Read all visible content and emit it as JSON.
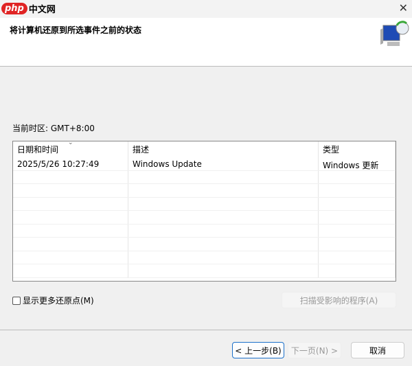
{
  "watermark": "php中文网",
  "window": {
    "close_icon": "close-icon"
  },
  "header": {
    "title": "将计算机还原到所选事件之前的状态"
  },
  "timezone_label": "当前时区: GMT+8:00",
  "table": {
    "columns": [
      "日期和时间",
      "描述",
      "类型"
    ],
    "rows": [
      {
        "date": "2025/5/26 10:27:49",
        "description": "Windows Update",
        "type": "Windows 更新"
      }
    ],
    "empty_rows": 8
  },
  "show_more_label": "显示更多还原点(M)",
  "scan_button": "扫描受影响的程序(A)",
  "footer": {
    "back": "< 上一步(B)",
    "next": "下一页(N) >",
    "cancel": "取消"
  }
}
